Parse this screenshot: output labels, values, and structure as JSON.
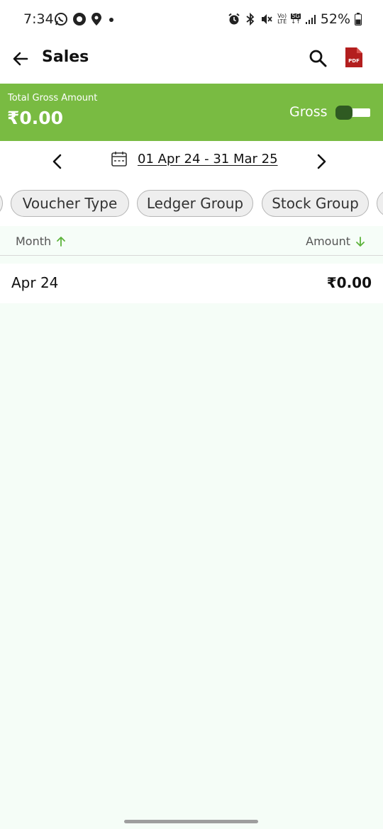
{
  "status_bar": {
    "time": "7:34",
    "network_top": "Vo)",
    "network_bottom": "LTE",
    "gen_top": "5G",
    "gen_bottom": "↓↑",
    "battery": "52%"
  },
  "app_bar": {
    "title": "Sales",
    "pdf_label": "PDF"
  },
  "summary": {
    "label": "Total Gross Amount",
    "amount": "₹0.00",
    "toggle_label": "Gross"
  },
  "date_range": {
    "text": "01 Apr 24 - 31 Mar 25"
  },
  "chips": [
    {
      "label": "Voucher Type"
    },
    {
      "label": "Ledger Group"
    },
    {
      "label": "Stock Group"
    }
  ],
  "table": {
    "columns": {
      "month": "Month",
      "amount": "Amount"
    },
    "rows": [
      {
        "month": "Apr 24",
        "amount": "₹0.00"
      }
    ]
  },
  "colors": {
    "accent_green": "#79bb42",
    "toggle_knob": "#2f5a22",
    "pdf_red": "#b31e1e",
    "sort_arrow": "#5cb33a"
  }
}
